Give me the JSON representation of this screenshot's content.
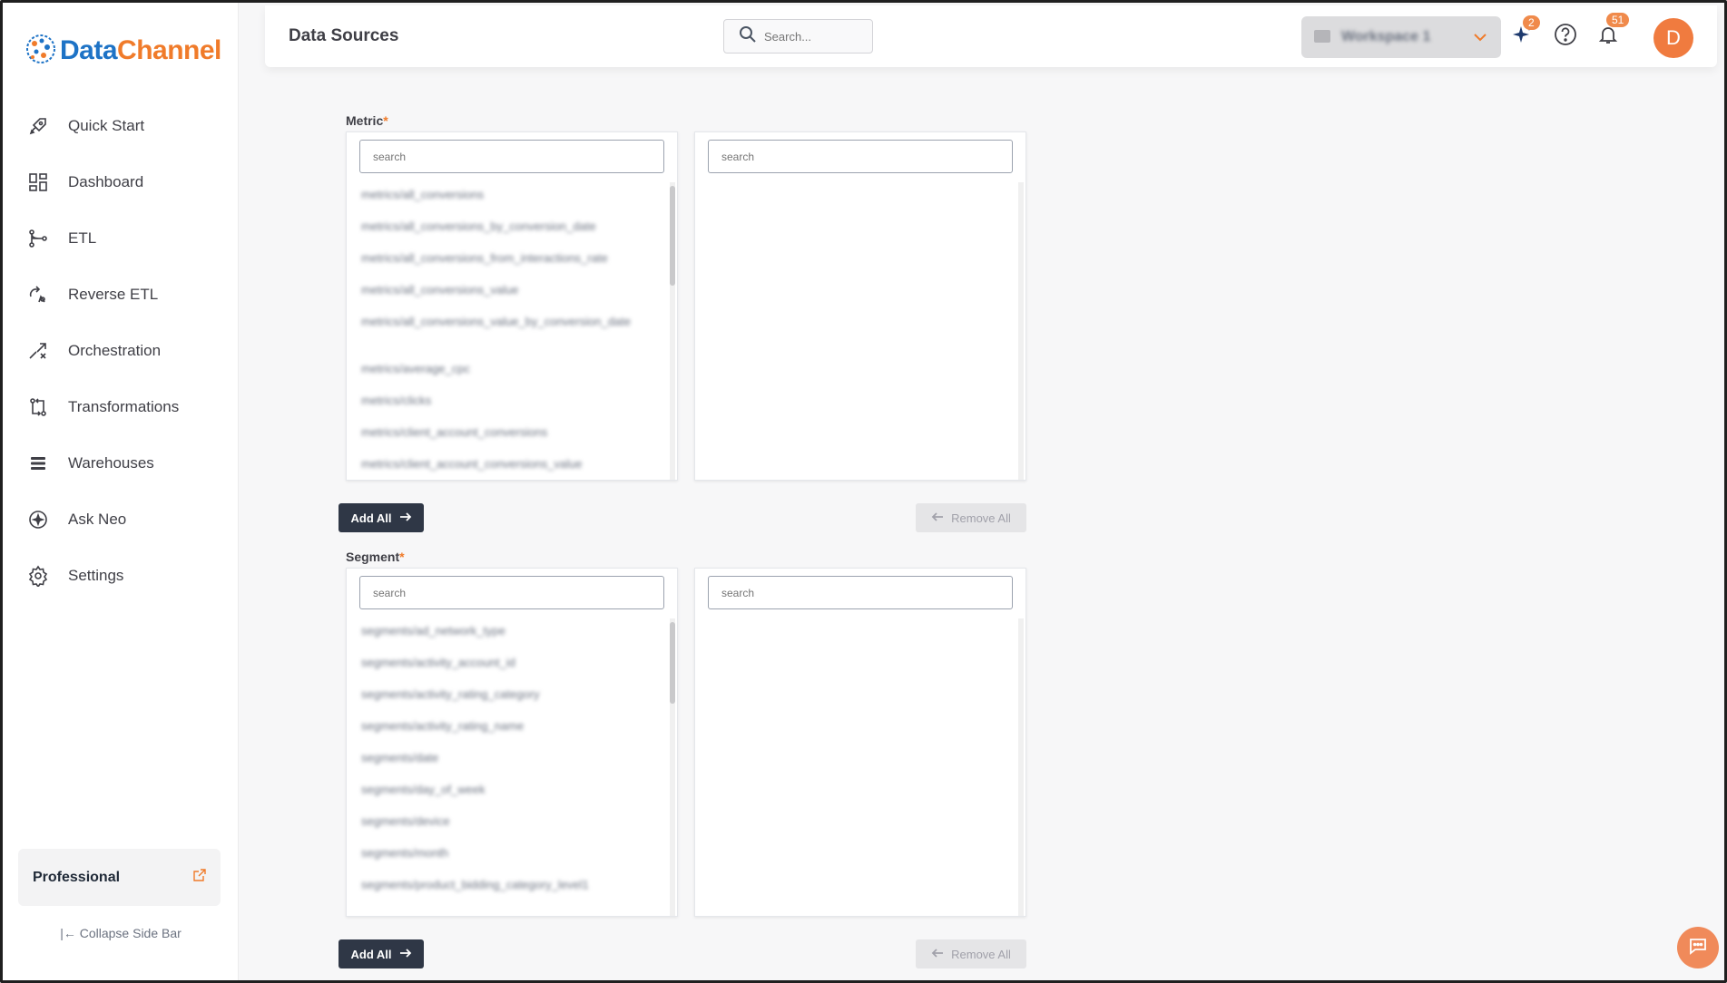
{
  "app": {
    "logo_part1": "Data",
    "logo_part2": "Channel",
    "page_title": "Data Sources",
    "brand_blue": "#1e73c6",
    "brand_orange": "#f07b2a"
  },
  "sidebar": {
    "items": [
      {
        "label": "Quick Start",
        "icon": "rocket-icon"
      },
      {
        "label": "Dashboard",
        "icon": "dashboard-grid-icon"
      },
      {
        "label": "ETL",
        "icon": "etl-flow-icon"
      },
      {
        "label": "Reverse ETL",
        "icon": "reverse-etl-icon"
      },
      {
        "label": "Orchestration",
        "icon": "orchestration-icon"
      },
      {
        "label": "Transformations",
        "icon": "transformations-icon"
      },
      {
        "label": "Warehouses",
        "icon": "warehouse-stack-icon"
      },
      {
        "label": "Ask Neo",
        "icon": "sparkle-icon"
      },
      {
        "label": "Settings",
        "icon": "gear-icon"
      }
    ],
    "plan_name": "Professional",
    "collapse_label": "Collapse Side Bar"
  },
  "header": {
    "search_placeholder": "Search...",
    "workspace_name": "Workspace 1",
    "ai_badge": "2",
    "notifications_badge": "51",
    "avatar_initial": "D"
  },
  "metric": {
    "label": "Metric",
    "required_mark": "*",
    "available_search_placeholder": "search",
    "selected_search_placeholder": "search",
    "available_items": [
      "metrics/all_conversions",
      "metrics/all_conversions_by_conversion_date",
      "metrics/all_conversions_from_interactions_rate",
      "metrics/all_conversions_value",
      "metrics/all_conversions_value_by_conversion_date",
      "metrics/average_cpc",
      "metrics/clicks",
      "metrics/client_account_conversions",
      "metrics/client_account_conversions_value"
    ],
    "add_all_label": "Add All",
    "remove_all_label": "Remove All"
  },
  "segment": {
    "label": "Segment",
    "required_mark": "*",
    "available_search_placeholder": "search",
    "selected_search_placeholder": "search",
    "available_items": [
      "segments/ad_network_type",
      "segments/activity_account_id",
      "segments/activity_rating_category",
      "segments/activity_rating_name",
      "segments/date",
      "segments/day_of_week",
      "segments/device",
      "segments/month",
      "segments/product_bidding_category_level1"
    ],
    "add_all_label": "Add All",
    "remove_all_label": "Remove All"
  }
}
